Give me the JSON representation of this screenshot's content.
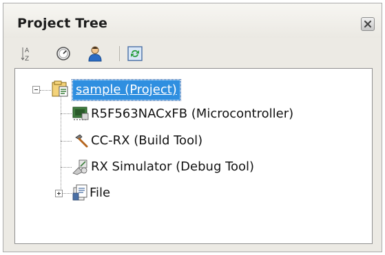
{
  "panel": {
    "title": "Project Tree",
    "close_icon": "close-icon"
  },
  "toolbar": {
    "buttons": [
      {
        "name": "sort-icon"
      },
      {
        "name": "timer-icon"
      },
      {
        "name": "user-icon"
      },
      {
        "name": "refresh-icon"
      }
    ]
  },
  "tree": {
    "root": {
      "label": "sample (Project)",
      "icon": "project-icon",
      "expanded": true,
      "selected": true
    },
    "children": [
      {
        "label": "R5F563NACxFB (Microcontroller)",
        "icon": "microcontroller-icon"
      },
      {
        "label": "CC-RX (Build Tool)",
        "icon": "build-tool-icon"
      },
      {
        "label": "RX Simulator (Debug Tool)",
        "icon": "debug-tool-icon"
      },
      {
        "label": "File",
        "icon": "file-folder-icon",
        "expanded": false
      }
    ]
  },
  "colors": {
    "selection": "#2f8fe0",
    "panel_bg": "#eceae4",
    "tree_bg": "#ffffff"
  }
}
